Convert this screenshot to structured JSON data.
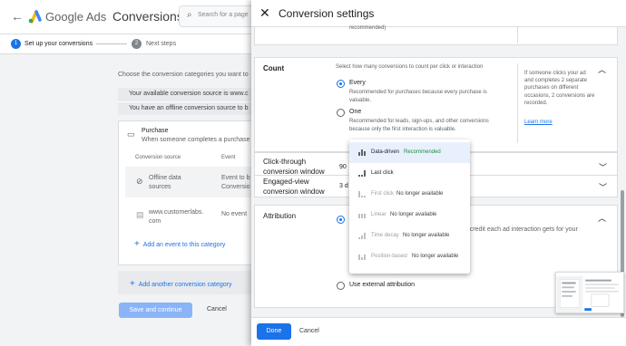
{
  "app": {
    "brand": "Google Ads",
    "page_title": "Conversions",
    "search_placeholder": "Search for a page"
  },
  "steps": [
    {
      "num": "1",
      "label": "Set up your conversions"
    },
    {
      "num": "2",
      "label": "Next steps"
    }
  ],
  "background": {
    "category_desc": "Choose the conversion categories you want to",
    "info1": "Your available conversion source is www.c",
    "info2": "You have an offline conversion source to b",
    "purchase_title": "Purchase",
    "purchase_sub": "When someone completes a purchase",
    "col_source": "Conversion source",
    "col_event": "Event",
    "row1_source_a": "Offline data",
    "row1_source_b": "sources",
    "row1_event_a": "Event to b",
    "row1_event_b": "Conversio",
    "row2_source_a": "www.customerlabs.",
    "row2_source_b": "com",
    "row2_event": "No event",
    "add_event": "Add an event to this category",
    "add_category": "Add another conversion category",
    "save": "Save and continue",
    "cancel": "Cancel"
  },
  "panel": {
    "title": "Conversion settings",
    "top_fragment": "recommended)",
    "count": {
      "label": "Count",
      "desc": "Select how many conversions to count per click or interaction",
      "every": "Every",
      "every_desc": "Recommended for purchases because every purchase is valuable.",
      "one": "One",
      "one_desc": "Recommended for leads, sign-ups, and other conversions because only the first interaction is valuable.",
      "help": "If someone clicks your ad and completes 2 separate purchases on different occasions, 2 conversions are recorded.",
      "learn_more": "Learn more",
      "selected": "every"
    },
    "click_through": {
      "label_a": "Click-through",
      "label_b": "conversion window",
      "value": "90"
    },
    "engaged_view": {
      "label_a": "Engaged-view",
      "label_b": "conversion window",
      "value": "3 d"
    },
    "attribution": {
      "label": "Attribution",
      "desc_a": "h credit each ad interaction gets for your",
      "desc_b": "s",
      "external": "Use external attribution"
    },
    "done": "Done",
    "cancel": "Cancel"
  },
  "dropdown": [
    {
      "label": "Data-driven",
      "tag": "Recommended",
      "selected": true,
      "disabled": false
    },
    {
      "label": "Last click",
      "tag": "",
      "selected": false,
      "disabled": false
    },
    {
      "label": "First click",
      "tag": "No longer available",
      "selected": false,
      "disabled": true
    },
    {
      "label": "Linear",
      "tag": "No longer available",
      "selected": false,
      "disabled": true
    },
    {
      "label": "Time decay",
      "tag": "No longer available",
      "selected": false,
      "disabled": true
    },
    {
      "label": "Position-based",
      "tag": "No longer available",
      "selected": false,
      "disabled": true
    }
  ],
  "colors": {
    "accent": "#1a73e8",
    "recommended": "#1e8e3e"
  }
}
